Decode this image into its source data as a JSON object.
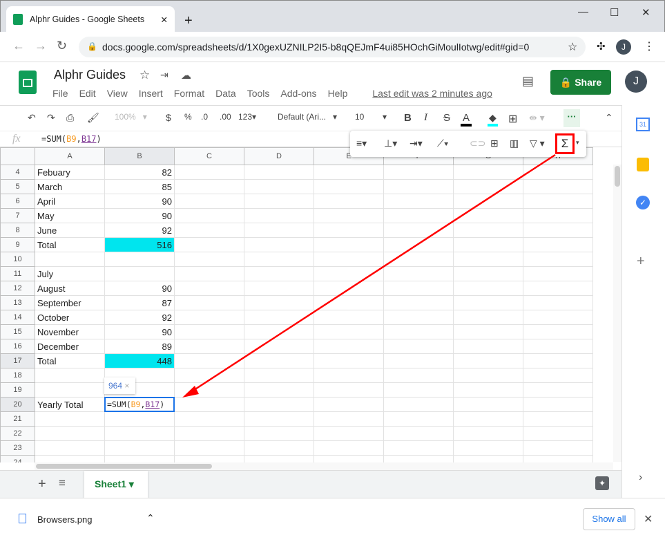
{
  "browser": {
    "tab_title": "Alphr Guides - Google Sheets",
    "url": "docs.google.com/spreadsheets/d/1X0gexUZNILP2I5-b8qQEJmF4ui85HOchGiMoulIotwg/edit#gid=0",
    "profile_initial": "J"
  },
  "doc": {
    "title": "Alphr Guides",
    "menus": [
      "File",
      "Edit",
      "View",
      "Insert",
      "Format",
      "Data",
      "Tools",
      "Add-ons",
      "Help"
    ],
    "last_edit": "Last edit was 2 minutes ago",
    "share_label": "Share",
    "user_initial": "J"
  },
  "toolbar": {
    "zoom": "100%",
    "currency": "$",
    "percent": "%",
    "dec_less": ".0",
    "dec_more": ".00",
    "format": "123",
    "font": "Default (Ari...",
    "font_size": "10",
    "bold": "B",
    "italic": "I",
    "strike": "S",
    "text_color": "A",
    "sum": "Σ",
    "text_color_hex": "#000000",
    "fill_color_hex": "#00ffff"
  },
  "formula_bar": {
    "fx": "fx",
    "prefix": "=SUM(",
    "ref1": "B9",
    "sep": ",",
    "ref2": "B17",
    "suffix": ")"
  },
  "columns": [
    "A",
    "B",
    "C",
    "D",
    "E",
    "F",
    "G",
    "H"
  ],
  "rows": [
    {
      "n": "4",
      "a": "Febuary",
      "b": "82"
    },
    {
      "n": "5",
      "a": "March",
      "b": "85"
    },
    {
      "n": "6",
      "a": "April",
      "b": "90"
    },
    {
      "n": "7",
      "a": "May",
      "b": "90"
    },
    {
      "n": "8",
      "a": "June",
      "b": "92"
    },
    {
      "n": "9",
      "a": "Total",
      "b": "516"
    },
    {
      "n": "10",
      "a": "",
      "b": ""
    },
    {
      "n": "11",
      "a": "July",
      "b": ""
    },
    {
      "n": "12",
      "a": "August",
      "b": "90"
    },
    {
      "n": "13",
      "a": "September",
      "b": "87"
    },
    {
      "n": "14",
      "a": "October",
      "b": "92"
    },
    {
      "n": "15",
      "a": "November",
      "b": "90"
    },
    {
      "n": "16",
      "a": "December",
      "b": "89"
    },
    {
      "n": "17",
      "a": "Total",
      "b": "448"
    },
    {
      "n": "18",
      "a": "",
      "b": ""
    },
    {
      "n": "19",
      "a": "",
      "b": ""
    },
    {
      "n": "20",
      "a": "Yearly Total",
      "b": ""
    },
    {
      "n": "21",
      "a": "",
      "b": ""
    },
    {
      "n": "22",
      "a": "",
      "b": ""
    },
    {
      "n": "23",
      "a": "",
      "b": ""
    },
    {
      "n": "24",
      "a": "",
      "b": ""
    }
  ],
  "tooltip": {
    "value": "964",
    "close": "×"
  },
  "sheet_tab": "Sheet1",
  "download": {
    "file": "Browsers.png",
    "show_all": "Show all"
  },
  "colors": {
    "accent": "#188038",
    "highlight": "#00e5ee",
    "annotation": "#ff0000"
  }
}
